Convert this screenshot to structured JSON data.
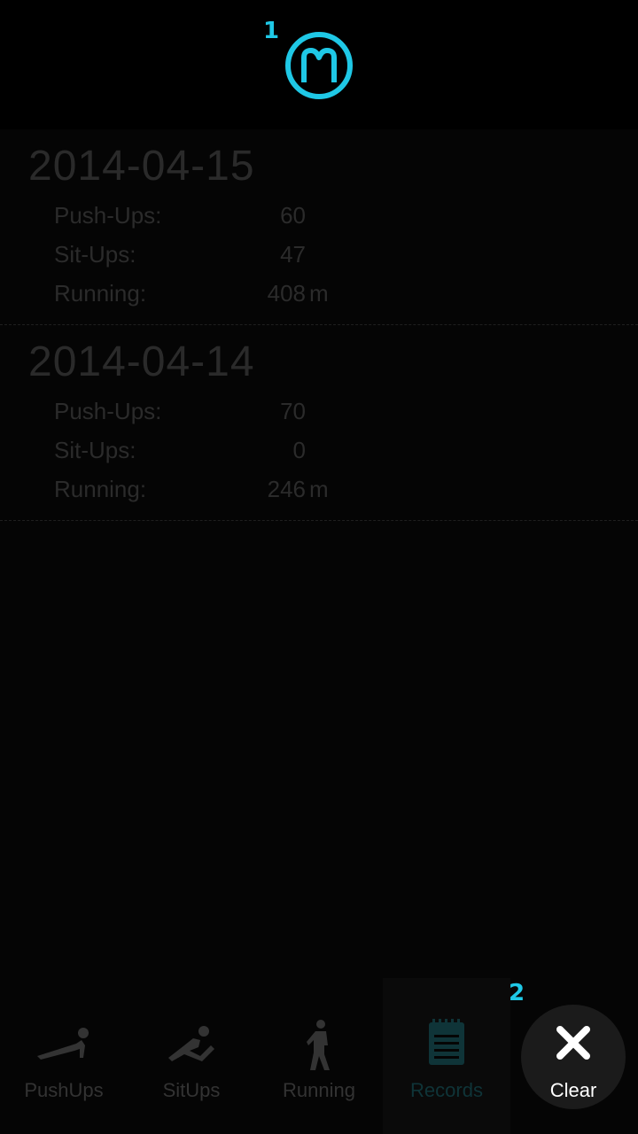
{
  "header": {
    "logo_icon": "m-circle-logo-icon",
    "accent_color": "#1fc8e6"
  },
  "markers": [
    "1",
    "2"
  ],
  "records": [
    {
      "date": "2014-04-15",
      "stats": [
        {
          "label": "Push-Ups:",
          "value": "60",
          "unit": ""
        },
        {
          "label": "Sit-Ups:",
          "value": "47",
          "unit": ""
        },
        {
          "label": "Running:",
          "value": "408",
          "unit": "m"
        }
      ]
    },
    {
      "date": "2014-04-14",
      "stats": [
        {
          "label": "Push-Ups:",
          "value": "70",
          "unit": ""
        },
        {
          "label": "Sit-Ups:",
          "value": "0",
          "unit": ""
        },
        {
          "label": "Running:",
          "value": "246",
          "unit": "m"
        }
      ]
    }
  ],
  "nav": {
    "items": [
      {
        "label": "PushUps",
        "icon": "pushup-icon"
      },
      {
        "label": "SitUps",
        "icon": "situp-icon"
      },
      {
        "label": "Running",
        "icon": "runner-icon"
      },
      {
        "label": "Records",
        "icon": "notepad-icon",
        "active": true
      }
    ],
    "clear_label": "Clear",
    "clear_icon": "close-icon"
  }
}
